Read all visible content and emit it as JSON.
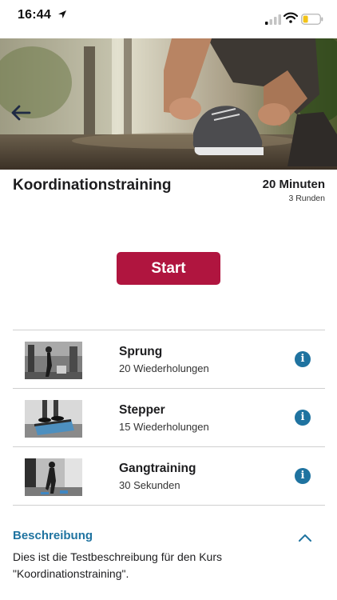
{
  "status_bar": {
    "time": "16:44",
    "icons": [
      "location-arrow-icon",
      "signal-icon",
      "wifi-icon",
      "battery-low-icon"
    ]
  },
  "course": {
    "title": "Koordinationstraining",
    "duration": "20 Minuten",
    "rounds": "3 Runden"
  },
  "actions": {
    "start_label": "Start"
  },
  "exercises": [
    {
      "name": "Sprung",
      "detail": "20 Wiederholungen"
    },
    {
      "name": "Stepper",
      "detail": "15 Wiederholungen"
    },
    {
      "name": "Gangtraining",
      "detail": "30 Sekunden"
    }
  ],
  "description": {
    "heading": "Beschreibung",
    "text": "Dies ist die Testbeschreibung für den Kurs \"Koordinationstraining\"."
  },
  "colors": {
    "accent": "#b0153f",
    "link_blue": "#1f73a0",
    "divider": "#cfcfcf"
  }
}
